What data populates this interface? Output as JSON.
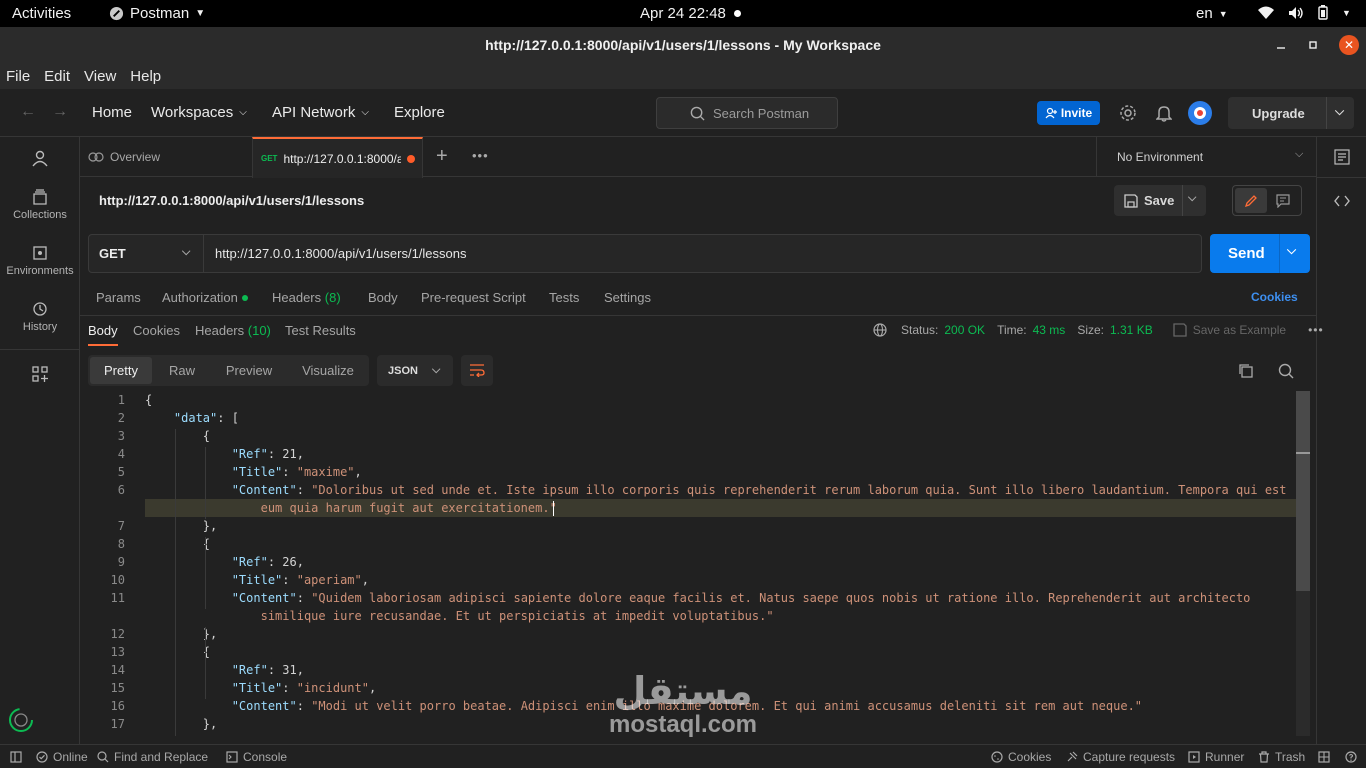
{
  "gnome": {
    "activities": "Activities",
    "app": "Postman",
    "datetime": "Apr 24  22:48",
    "lang": "en"
  },
  "window": {
    "title": "http://127.0.0.1:8000/api/v1/users/1/lessons - My Workspace"
  },
  "menu": [
    "File",
    "Edit",
    "View",
    "Help"
  ],
  "header": {
    "home": "Home",
    "workspaces": "Workspaces",
    "api_network": "API Network",
    "explore": "Explore",
    "search_placeholder": "Search Postman",
    "invite": "Invite",
    "upgrade": "Upgrade"
  },
  "sidebar": [
    {
      "label": ""
    },
    {
      "label": "Collections"
    },
    {
      "label": "Environments"
    },
    {
      "label": "History"
    }
  ],
  "tabs": {
    "overview": "Overview",
    "method": "GET",
    "request": "http://127.0.0.1:8000/api/v1/users/1/lessons",
    "environment": "No Environment"
  },
  "request": {
    "title": "http://127.0.0.1:8000/api/v1/users/1/lessons",
    "save": "Save",
    "method": "GET",
    "url": "http://127.0.0.1:8000/api/v1/users/1/lessons",
    "send": "Send",
    "tabs": [
      "Params",
      "Authorization",
      "Headers",
      "(8)",
      "Body",
      "Pre-request Script",
      "Tests",
      "Settings"
    ],
    "cookies": "Cookies"
  },
  "response": {
    "tabs": [
      "Body",
      "Cookies",
      "Headers",
      "(10)",
      "Test Results"
    ],
    "status_label": "Status:",
    "status": "200 OK",
    "time_label": "Time:",
    "time": "43 ms",
    "size_label": "Size:",
    "size": "1.31 KB",
    "save_example": "Save as Example",
    "views": [
      "Pretty",
      "Raw",
      "Preview",
      "Visualize"
    ],
    "format": "JSON"
  },
  "code": {
    "line_numbers": [
      "1",
      "2",
      "3",
      "4",
      "5",
      "6",
      "7",
      "8",
      "9",
      "10",
      "11",
      "12",
      "13",
      "14",
      "15",
      "16",
      "17"
    ],
    "lines": [
      [
        {
          "t": "{",
          "c": "n"
        }
      ],
      [
        {
          "t": "    ",
          "c": "n"
        },
        {
          "t": "\"data\"",
          "c": "k"
        },
        {
          "t": ": [",
          "c": "n"
        }
      ],
      [
        {
          "t": "        {",
          "c": "n"
        }
      ],
      [
        {
          "t": "            ",
          "c": "n"
        },
        {
          "t": "\"Ref\"",
          "c": "k"
        },
        {
          "t": ": 21,",
          "c": "n"
        }
      ],
      [
        {
          "t": "            ",
          "c": "n"
        },
        {
          "t": "\"Title\"",
          "c": "k"
        },
        {
          "t": ": ",
          "c": "n"
        },
        {
          "t": "\"maxime\"",
          "c": "s"
        },
        {
          "t": ",",
          "c": "n"
        }
      ],
      [
        {
          "t": "            ",
          "c": "n"
        },
        {
          "t": "\"Content\"",
          "c": "k"
        },
        {
          "t": ": ",
          "c": "n"
        },
        {
          "t": "\"Doloribus ut sed unde et. Iste ipsum illo corporis quis reprehenderit rerum laborum quia. Sunt illo libero laudantium. Tempora qui est",
          "c": "s"
        }
      ],
      [
        {
          "t": "                eum quia harum fugit aut exercitationem.\"",
          "c": "s"
        }
      ],
      [
        {
          "t": "        },",
          "c": "n"
        }
      ],
      [
        {
          "t": "        {",
          "c": "n"
        }
      ],
      [
        {
          "t": "            ",
          "c": "n"
        },
        {
          "t": "\"Ref\"",
          "c": "k"
        },
        {
          "t": ": 26,",
          "c": "n"
        }
      ],
      [
        {
          "t": "            ",
          "c": "n"
        },
        {
          "t": "\"Title\"",
          "c": "k"
        },
        {
          "t": ": ",
          "c": "n"
        },
        {
          "t": "\"aperiam\"",
          "c": "s"
        },
        {
          "t": ",",
          "c": "n"
        }
      ],
      [
        {
          "t": "            ",
          "c": "n"
        },
        {
          "t": "\"Content\"",
          "c": "k"
        },
        {
          "t": ": ",
          "c": "n"
        },
        {
          "t": "\"Quidem laboriosam adipisci sapiente dolore eaque facilis et. Natus saepe quos nobis ut ratione illo. Reprehenderit aut architecto",
          "c": "s"
        }
      ],
      [
        {
          "t": "                similique iure recusandae. Et ut perspiciatis at impedit voluptatibus.\"",
          "c": "s"
        }
      ],
      [
        {
          "t": "        },",
          "c": "n"
        }
      ],
      [
        {
          "t": "        {",
          "c": "n"
        }
      ],
      [
        {
          "t": "            ",
          "c": "n"
        },
        {
          "t": "\"Ref\"",
          "c": "k"
        },
        {
          "t": ": 31,",
          "c": "n"
        }
      ],
      [
        {
          "t": "            ",
          "c": "n"
        },
        {
          "t": "\"Title\"",
          "c": "k"
        },
        {
          "t": ": ",
          "c": "n"
        },
        {
          "t": "\"incidunt\"",
          "c": "s"
        },
        {
          "t": ",",
          "c": "n"
        }
      ],
      [
        {
          "t": "            ",
          "c": "n"
        },
        {
          "t": "\"Content\"",
          "c": "k"
        },
        {
          "t": ": ",
          "c": "n"
        },
        {
          "t": "\"Modi ut velit porro beatae. Adipisci enim illo maxime dolorem. Et qui animi accusamus deleniti sit rem aut neque.\"",
          "c": "s"
        }
      ],
      [
        {
          "t": "        },",
          "c": "n"
        }
      ]
    ]
  },
  "statusbar": {
    "online": "Online",
    "find_replace": "Find and Replace",
    "console": "Console",
    "cookies": "Cookies",
    "capture": "Capture requests",
    "runner": "Runner",
    "trash": "Trash"
  },
  "watermark": {
    "arabic": "مستقل",
    "latin": "mostaql.com"
  },
  "colors": {
    "accent": "#ff6c37",
    "send": "#097bed",
    "invite": "#0265d2",
    "status_green": "#0cbb52",
    "json_key": "#9cdcfe",
    "json_string": "#ce9178"
  }
}
